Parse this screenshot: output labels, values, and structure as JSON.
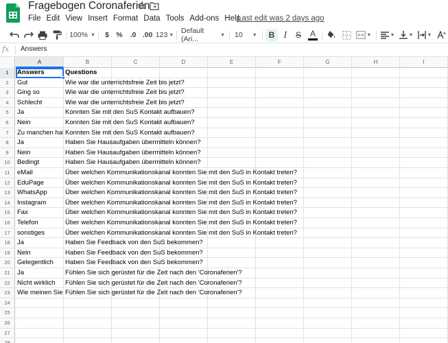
{
  "app": {
    "doc_title": "Fragebogen Coronaferien",
    "last_edit": "Last edit was 2 days ago",
    "logo_icon": "google-sheets-logo",
    "brand_color": "#0f9d58"
  },
  "menu": [
    "File",
    "Edit",
    "View",
    "Insert",
    "Format",
    "Data",
    "Tools",
    "Add-ons",
    "Help"
  ],
  "toolbar": {
    "zoom": "100%",
    "currency": "$",
    "percent": "%",
    "dec_decrease": ".0",
    "dec_increase": ".00",
    "more_formats": "123",
    "font": "Default (Ari...",
    "font_size": "10",
    "bold": "B",
    "italic": "I",
    "strike": "S",
    "text_color": "A"
  },
  "formula_bar": {
    "fx": "fx",
    "value": "Answers"
  },
  "columns": [
    "A",
    "B",
    "C",
    "D",
    "E",
    "F",
    "G",
    "H",
    "I"
  ],
  "row_numbers": [
    "1",
    "2",
    "3",
    "4",
    "5",
    "6",
    "7",
    "8",
    "9",
    "10",
    "11",
    "12",
    "13",
    "14",
    "15",
    "16",
    "17",
    "18",
    "19",
    "20",
    "21",
    "22",
    "23",
    "24",
    "25",
    "26",
    "27",
    "28"
  ],
  "rows": [
    {
      "a": "Answers",
      "b": "Questions"
    },
    {
      "a": "Gut",
      "b": "Wie war die unterrichtsfreie Zeit bis jetzt?"
    },
    {
      "a": "Ging so",
      "b": "Wie war die unterrichtsfreie Zeit bis jetzt?"
    },
    {
      "a": "Schlecht",
      "b": "Wie war die unterrichtsfreie Zeit bis jetzt?"
    },
    {
      "a": "Ja",
      "b": "Konnten Sie mit den SuS Kontakt aufbauen?"
    },
    {
      "a": "Nein",
      "b": "Konnten Sie mit den SuS Kontakt aufbauen?"
    },
    {
      "a": "Zu manchen haben wir Kontakt",
      "b": "Konnten Sie mit den SuS Kontakt aufbauen?"
    },
    {
      "a": "Ja",
      "b": "Haben Sie Hausaufgaben übermitteln können?"
    },
    {
      "a": "Nein",
      "b": "Haben Sie Hausaufgaben übermitteln können?"
    },
    {
      "a": "Bedingt",
      "b": "Haben Sie Hausaufgaben übermitteln können?"
    },
    {
      "a": "eMail",
      "b": "Über welchen Kommunikationskanal konnten Sie mit den SuS in Kontakt treten?"
    },
    {
      "a": "EduPage",
      "b": "Über welchen Kommunikationskanal konnten Sie mit den SuS in Kontakt treten?"
    },
    {
      "a": "WhatsApp",
      "b": "Über welchen Kommunikationskanal konnten Sie mit den SuS in Kontakt treten?"
    },
    {
      "a": "Instagram",
      "b": "Über welchen Kommunikationskanal konnten Sie mit den SuS in Kontakt treten?"
    },
    {
      "a": "Fax",
      "b": "Über welchen Kommunikationskanal konnten Sie mit den SuS in Kontakt treten?"
    },
    {
      "a": "Telefon",
      "b": "Über welchen Kommunikationskanal konnten Sie mit den SuS in Kontakt treten?"
    },
    {
      "a": "sonstiges",
      "b": "Über welchen Kommunikationskanal konnten Sie mit den SuS in Kontakt treten?"
    },
    {
      "a": "Ja",
      "b": "Haben Sie Feedback von den SuS bekommen?"
    },
    {
      "a": "Nein",
      "b": "Haben Sie Feedback von den SuS bekommen?"
    },
    {
      "a": "Gelegentlich",
      "b": "Haben Sie Feedback von den SuS bekommen?"
    },
    {
      "a": "Ja",
      "b": "Fühlen Sie sich gerüstet für die Zeit nach den 'Coronaferien'?"
    },
    {
      "a": "Nicht wirklich",
      "b": "Fühlen Sie sich gerüstet für die Zeit nach den 'Coronaferien'?"
    },
    {
      "a": "Wie meinen Sie das?",
      "b": "Fühlen Sie sich gerüstet für die Zeit nach den 'Coronaferien'?"
    },
    {
      "a": "",
      "b": ""
    },
    {
      "a": "",
      "b": ""
    },
    {
      "a": "",
      "b": ""
    },
    {
      "a": "",
      "b": ""
    },
    {
      "a": "",
      "b": ""
    }
  ],
  "selection": {
    "active_cell": "A1"
  }
}
